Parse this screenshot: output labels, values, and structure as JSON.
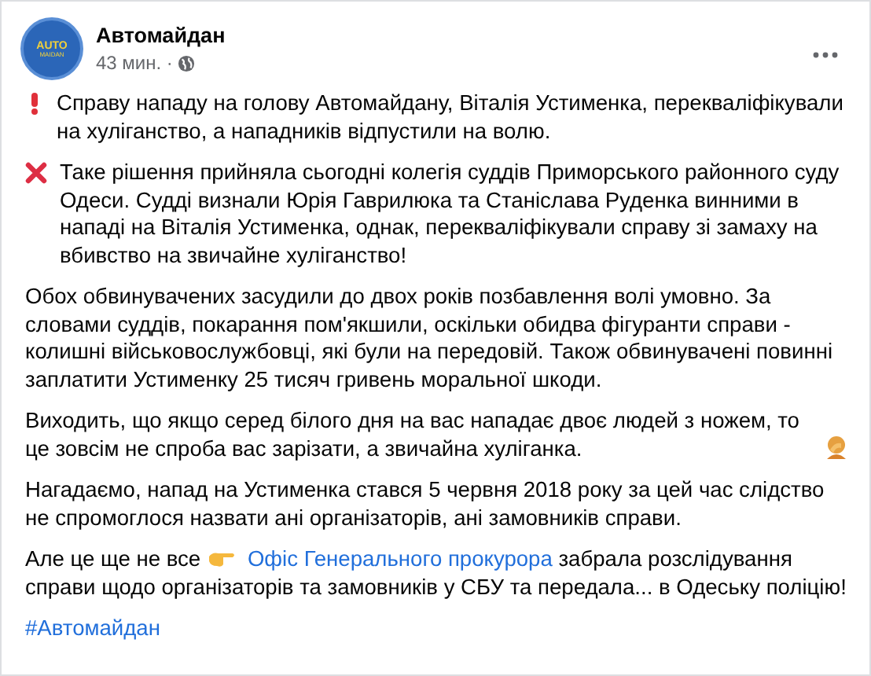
{
  "post": {
    "author": "Автомайдан",
    "avatar_text": [
      "AUTO",
      "MAIDAN"
    ],
    "time": "43 мин. ·",
    "paragraphs": [
      {
        "kind": "alert",
        "text": "Справу нападу на голову Автомайдану, Віталія Устименка, перекваліфікували на хуліганство, а нападників відпустили на волю."
      },
      {
        "kind": "cross",
        "text": "Таке рішення прийняла сьогодні колегія суддів Приморського районного суду Одеси. Судді визнали Юрія Гаврилюка та Станіслава Руденка винними в нападі на Віталія Устименка, однак, перекваліфікували  справу зі замаху на вбивство на звичайне хуліганство!"
      },
      {
        "kind": "plain",
        "text": "Обох обвинувачених засудили до двох років позбавлення волі умовно. За словами суддів, покарання пом'якшили, оскільки обидва фігуранти справи - колишні військовослужбовці, які були на передовій. Також обвинувачені повинні заплатити Устименку 25 тисяч гривень моральної шкоди."
      },
      {
        "kind": "facepalm",
        "text": "Виходить, що якщо серед білого дня на вас нападає двоє людей з ножем, то це зовсім не спроба вас зарізати, а звичайна хуліганка."
      },
      {
        "kind": "plain",
        "text": "Нагадаємо, напад на Устименка стався 5 червня 2018 року за цей час слідство не спромоглося назвати ані організаторів, ані замовників справи."
      },
      {
        "kind": "link",
        "text": "Але це ще не все",
        "link": "Офіс Генерального прокурора",
        "after": "забрала розслідування справи щодо організаторів та замовників у СБУ та передала... в Одеську поліцію!"
      }
    ],
    "hashtag": "#Автомайдан"
  }
}
